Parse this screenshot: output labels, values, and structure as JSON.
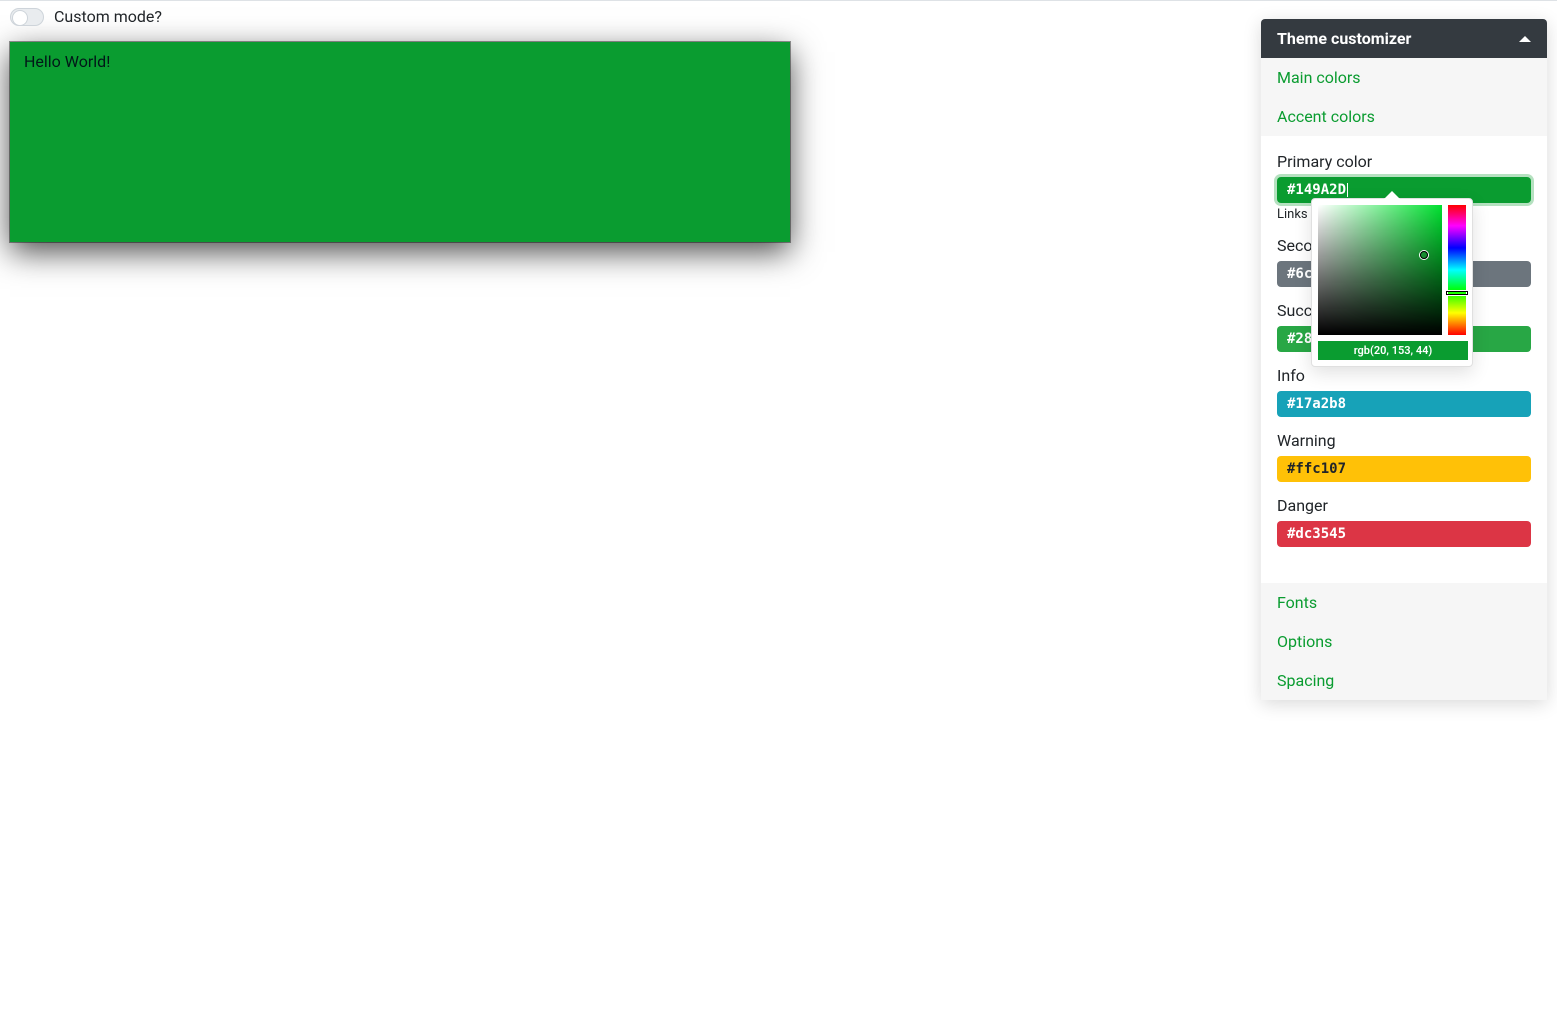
{
  "topbar": {
    "toggle_label": "Custom mode?"
  },
  "hello_box": {
    "text": "Hello World!",
    "bg_color": "#0a9c30"
  },
  "customizer": {
    "title": "Theme customizer",
    "sections": {
      "main_colors": "Main colors",
      "accent_colors": "Accent colors",
      "fonts": "Fonts",
      "options": "Options",
      "spacing": "Spacing"
    },
    "accent": {
      "primary": {
        "label": "Primary color",
        "value": "#149A2D",
        "help": "Links a"
      },
      "secondary": {
        "label": "Secor",
        "value": "#6c7"
      },
      "success": {
        "label": "Succe",
        "value": "#28a"
      },
      "info": {
        "label": "Info",
        "value": "#17a2b8"
      },
      "warning": {
        "label": "Warning",
        "value": "#ffc107"
      },
      "danger": {
        "label": "Danger",
        "value": "#dc3545"
      }
    }
  },
  "color_picker": {
    "readout": "rgb(20, 153, 44)",
    "hue_hex": "#00e030"
  },
  "colors": {
    "brand_green": "#0a9c30",
    "secondary": "#6c757d",
    "success": "#28a745",
    "info": "#17a2b8",
    "warning": "#ffc107",
    "danger": "#dc3545",
    "header_bg": "#343a40"
  }
}
